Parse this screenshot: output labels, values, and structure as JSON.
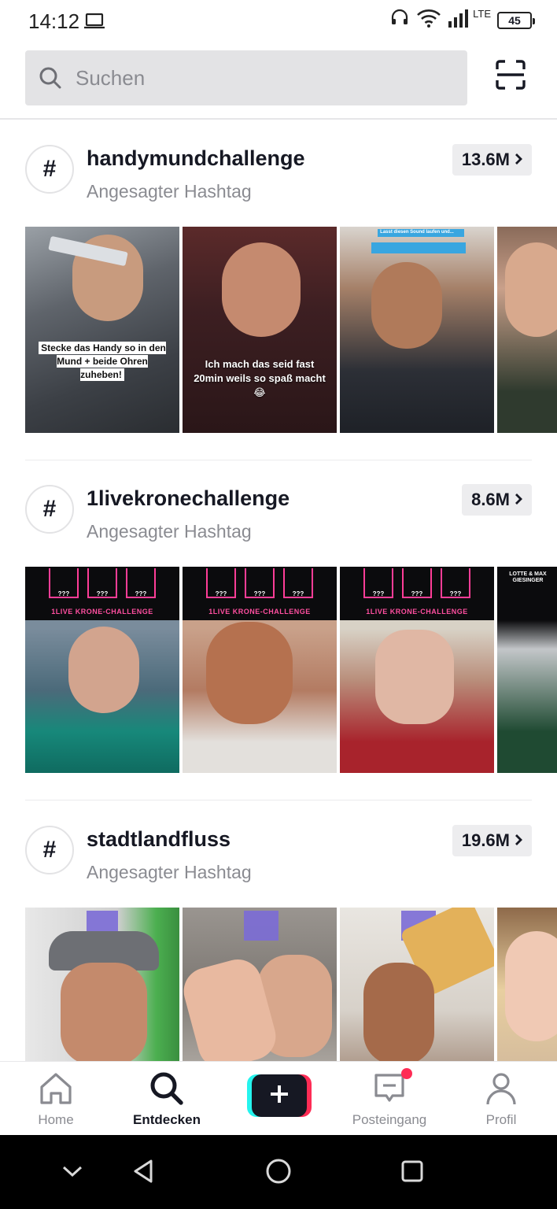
{
  "status_bar": {
    "time": "14:12",
    "network": "LTE",
    "battery": "45"
  },
  "search": {
    "placeholder": "Suchen"
  },
  "sections": [
    {
      "hashtag_symbol": "#",
      "title": "handymundchallenge",
      "subtitle": "Angesagter Hashtag",
      "count": "13.6M",
      "thumbnails": [
        {
          "caption": "Stecke das Handy so in den Mund + beide Ohren zuheben!"
        },
        {
          "caption": "Ich mach das seid fast 20min weils so spaß macht😂"
        },
        {
          "caption": "Lasst diesen Sound laufen und..."
        },
        {
          "caption": ""
        }
      ]
    },
    {
      "hashtag_symbol": "#",
      "title": "1livekronechallenge",
      "subtitle": "Angesagter Hashtag",
      "count": "8.6M",
      "thumbnails": [
        {
          "caption": "1LIVE KRONE-CHALLENGE",
          "slot_text": "???"
        },
        {
          "caption": "1LIVE KRONE-CHALLENGE",
          "slot_text": "???"
        },
        {
          "caption": "1LIVE KRONE-CHALLENGE",
          "slot_text": "???"
        },
        {
          "caption": "LOTTE & MAX GIESINGER"
        }
      ]
    },
    {
      "hashtag_symbol": "#",
      "title": "stadtlandfluss",
      "subtitle": "Angesagter Hashtag",
      "count": "19.6M",
      "thumbnails": [
        {
          "caption": ""
        },
        {
          "caption": ""
        },
        {
          "caption": ""
        },
        {
          "caption": ""
        }
      ]
    }
  ],
  "bottom_nav": {
    "home": "Home",
    "discover": "Entdecken",
    "create": "+",
    "inbox": "Posteingang",
    "profile": "Profil"
  },
  "colors": {
    "accent_red": "#fe2c55",
    "accent_cyan": "#25f4ee",
    "text_primary": "#161823",
    "text_secondary": "#8a8b91"
  }
}
